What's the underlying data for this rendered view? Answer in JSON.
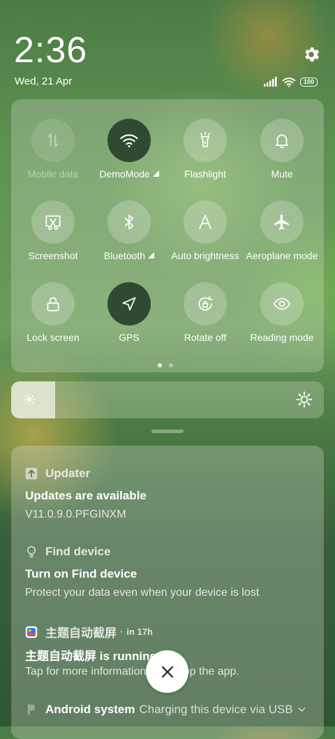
{
  "header": {
    "time": "2:36",
    "date": "Wed, 21 Apr",
    "battery": "100"
  },
  "quick_settings": {
    "tiles": [
      {
        "label": "Mobile data",
        "icon": "mobile-data-icon",
        "state": "disabled"
      },
      {
        "label": "DemoMode",
        "icon": "wifi-icon",
        "state": "on",
        "has_more": true
      },
      {
        "label": "Flashlight",
        "icon": "flashlight-icon",
        "state": "off"
      },
      {
        "label": "Mute",
        "icon": "bell-icon",
        "state": "off"
      },
      {
        "label": "Screenshot",
        "icon": "screenshot-icon",
        "state": "off"
      },
      {
        "label": "Bluetooth",
        "icon": "bluetooth-icon",
        "state": "off",
        "has_more": true
      },
      {
        "label": "Auto brightness",
        "icon": "auto-brightness-icon",
        "state": "off"
      },
      {
        "label": "Aeroplane mode",
        "icon": "airplane-icon",
        "state": "off"
      },
      {
        "label": "Lock screen",
        "icon": "lock-icon",
        "state": "off"
      },
      {
        "label": "GPS",
        "icon": "location-arrow-icon",
        "state": "on"
      },
      {
        "label": "Rotate off",
        "icon": "rotation-lock-icon",
        "state": "off"
      },
      {
        "label": "Reading mode",
        "icon": "eye-icon",
        "state": "off"
      }
    ],
    "page_count": 2,
    "current_page": 1
  },
  "brightness": {
    "level_fraction": 0.14
  },
  "notifications": [
    {
      "app": "Updater",
      "title": "Updates are available",
      "body": "V11.0.9.0.PFGINXM"
    },
    {
      "app": "Find device",
      "title": "Turn on Find device",
      "body": "Protect your data even when your device is lost"
    },
    {
      "app": "主题自动截屏",
      "time": "in 17h",
      "title": "主题自动截屏 is running",
      "body": "Tap for more information or to stop the app."
    },
    {
      "app": "Android system",
      "summary": "Charging this device via USB"
    }
  ],
  "colors": {
    "tile_on": "#2f4a32",
    "accent_white": "#ffffff"
  }
}
